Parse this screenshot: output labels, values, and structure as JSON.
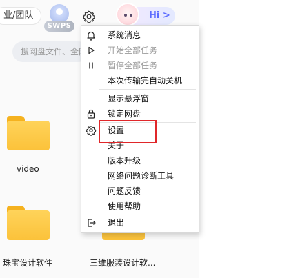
{
  "header": {
    "team_label": "业/团队",
    "swps_badge": "SWPS",
    "hi_label": "Hi >",
    "search_placeholder": "搜网盘文件、全网"
  },
  "files": [
    {
      "name": ""
    },
    {
      "name": "video"
    },
    {
      "name": "珠宝设计软件"
    },
    {
      "name": "三维服装设计软..."
    }
  ],
  "menu": {
    "items": [
      {
        "label": "系统消息",
        "icon": "bell-icon",
        "enabled": true
      },
      {
        "label": "开始全部任务",
        "icon": "play-icon",
        "enabled": false
      },
      {
        "label": "暂停全部任务",
        "icon": "pause-icon",
        "enabled": false
      },
      {
        "label": "本次传输完自动关机",
        "icon": "",
        "enabled": true
      },
      {
        "label": "显示悬浮窗",
        "icon": "",
        "enabled": true
      },
      {
        "label": "锁定网盘",
        "icon": "lock-icon",
        "enabled": true
      },
      {
        "label": "设置",
        "icon": "gear-icon",
        "enabled": true,
        "highlighted": true
      },
      {
        "label": "关于",
        "icon": "",
        "enabled": true
      },
      {
        "label": "版本升级",
        "icon": "",
        "enabled": true
      },
      {
        "label": "网络问题诊断工具",
        "icon": "",
        "enabled": true
      },
      {
        "label": "问题反馈",
        "icon": "",
        "enabled": true
      },
      {
        "label": "使用帮助",
        "icon": "",
        "enabled": true
      },
      {
        "label": "退出",
        "icon": "exit-icon",
        "enabled": true
      }
    ]
  },
  "colors": {
    "highlight_border": "#e0272a",
    "folder": "#fbc23a",
    "disabled_text": "#9a9a9a"
  }
}
